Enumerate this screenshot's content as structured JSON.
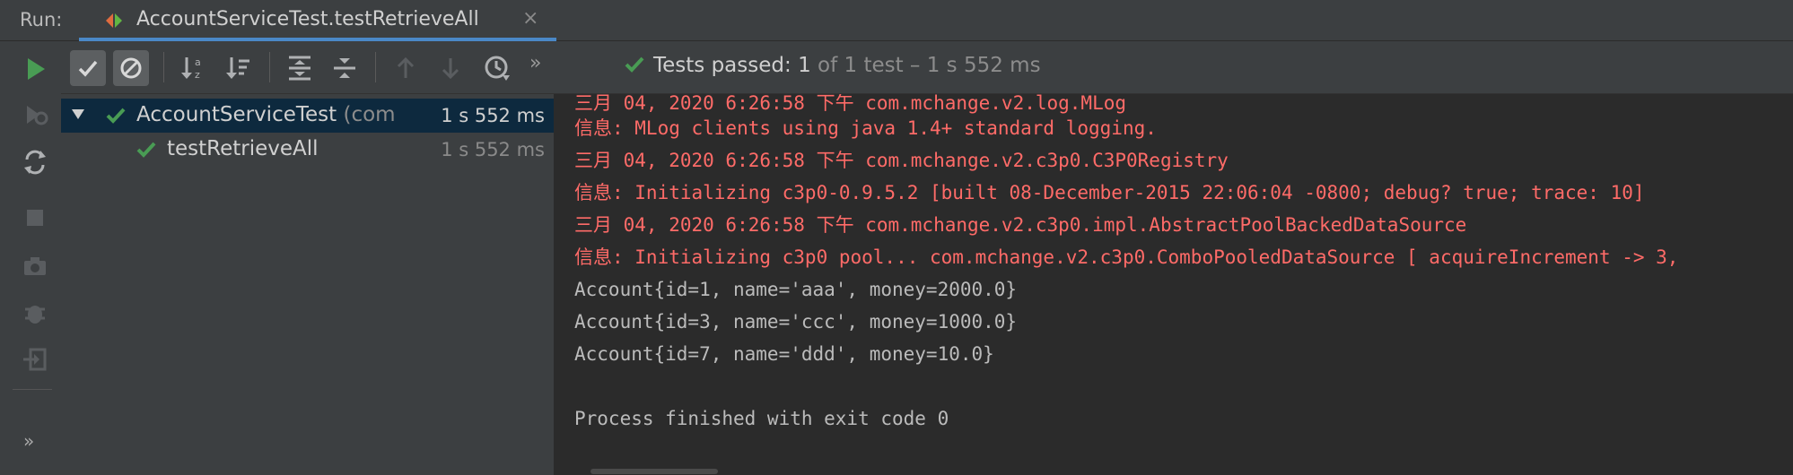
{
  "run_panel": {
    "label": "Run:",
    "tab": {
      "title": "AccountServiceTest.testRetrieveAll",
      "close": "×"
    }
  },
  "toolbar": {
    "more": "»"
  },
  "left_toolbar": {
    "more": "»"
  },
  "status": {
    "passed_label": "Tests passed:",
    "passed_count": "1",
    "rest": "of 1 test – 1 s 552 ms",
    "color": "#499c54"
  },
  "tree": {
    "root": {
      "name": "AccountServiceTest",
      "package": "(com",
      "duration": "1 s 552 ms"
    },
    "child": {
      "name": "testRetrieveAll",
      "duration": "1 s 552 ms"
    }
  },
  "console": {
    "lines": [
      {
        "type": "err",
        "text": "三月 04, 2020 6:26:58 下午 com.mchange.v2.log.MLog"
      },
      {
        "type": "err",
        "text": "信息: MLog clients using java 1.4+ standard logging."
      },
      {
        "type": "err",
        "text": "三月 04, 2020 6:26:58 下午 com.mchange.v2.c3p0.C3P0Registry"
      },
      {
        "type": "err",
        "text": "信息: Initializing c3p0-0.9.5.2 [built 08-December-2015 22:06:04 -0800; debug? true; trace: 10]"
      },
      {
        "type": "err",
        "text": "三月 04, 2020 6:26:58 下午 com.mchange.v2.c3p0.impl.AbstractPoolBackedDataSource"
      },
      {
        "type": "err",
        "text": "信息: Initializing c3p0 pool... com.mchange.v2.c3p0.ComboPooledDataSource [ acquireIncrement -> 3,"
      },
      {
        "type": "out",
        "text": "Account{id=1, name='aaa', money=2000.0}"
      },
      {
        "type": "out",
        "text": "Account{id=3, name='ccc', money=1000.0}"
      },
      {
        "type": "out",
        "text": "Account{id=7, name='ddd', money=10.0}"
      },
      {
        "type": "out",
        "text": ""
      },
      {
        "type": "out",
        "text": "Process finished with exit code 0"
      }
    ]
  },
  "colors": {
    "error_text": "#ff6b68",
    "pass_green": "#499c54",
    "accent": "#4a88c7"
  }
}
